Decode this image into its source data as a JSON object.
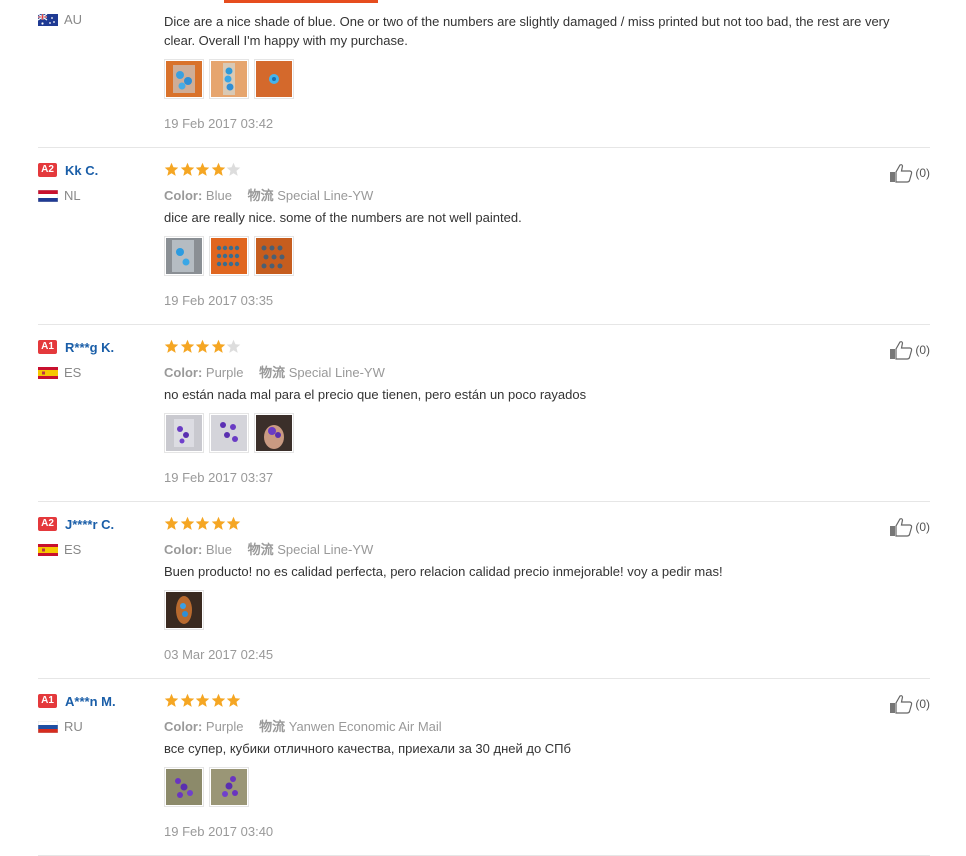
{
  "reviews": [
    {
      "country": "AU",
      "text": "Dice are a nice shade of blue. One or two of the numbers are slightly damaged / miss printed but not too bad, the rest are very clear. Overall I'm happy with my purchase.",
      "date": "19 Feb 2017 03:42"
    },
    {
      "badge": "A2",
      "name": "Kk C.",
      "country": "NL",
      "stars": 4,
      "color_label": "Color:",
      "color_value": "Blue",
      "ship_label": "物流",
      "ship_value": "Special Line-YW",
      "text": "dice are really nice. some of the numbers are not well painted.",
      "date": "19 Feb 2017 03:35",
      "likes": "(0)"
    },
    {
      "badge": "A1",
      "name": "R***g K.",
      "country": "ES",
      "stars": 4,
      "color_label": "Color:",
      "color_value": "Purple",
      "ship_label": "物流",
      "ship_value": "Special Line-YW",
      "text": "no están nada mal para el precio que tienen, pero están un poco rayados",
      "date": "19 Feb 2017 03:37",
      "likes": "(0)"
    },
    {
      "badge": "A2",
      "name": "J****r C.",
      "country": "ES",
      "stars": 5,
      "color_label": "Color:",
      "color_value": "Blue",
      "ship_label": "物流",
      "ship_value": "Special Line-YW",
      "text": "Buen producto! no es calidad perfecta, pero relacion calidad precio inmejorable! voy a pedir mas!",
      "date": "03 Mar 2017 02:45",
      "likes": "(0)"
    },
    {
      "badge": "A1",
      "name": "A***n M.",
      "country": "RU",
      "stars": 5,
      "color_label": "Color:",
      "color_value": "Purple",
      "ship_label": "物流",
      "ship_value": "Yanwen Economic Air Mail",
      "text": "все супер, кубики отличного качества, приехали за 30 дней до СПб",
      "date": "19 Feb 2017 03:40",
      "likes": "(0)"
    }
  ],
  "colors": {
    "accent": "#e64d1e",
    "star": "#f5a623",
    "star_empty": "#dddddd",
    "name": "#1a5ea8",
    "badge": "#e4393c"
  }
}
